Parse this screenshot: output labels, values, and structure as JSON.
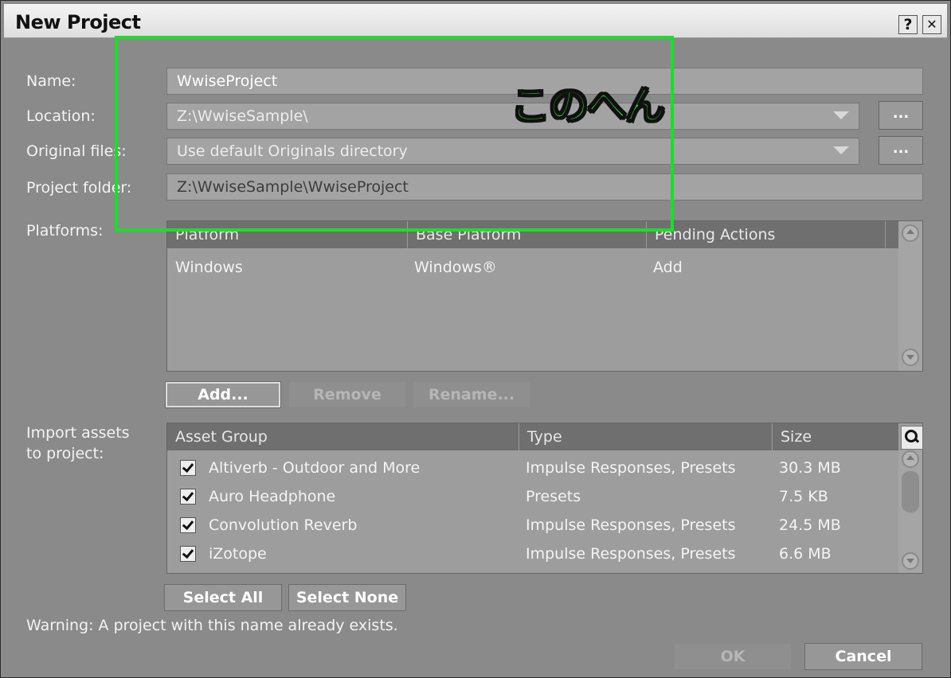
{
  "window": {
    "title": "New Project",
    "help_label": "?",
    "close_label": "✕"
  },
  "form": {
    "name_label": "Name:",
    "name_value": "WwiseProject",
    "location_label": "Location:",
    "location_value": "Z:\\WwiseSample\\",
    "originals_label": "Original files:",
    "originals_value": "Use default Originals directory",
    "project_folder_label": "Project folder:",
    "project_folder_value": "Z:\\WwiseSample\\WwiseProject",
    "browse_label": "..."
  },
  "platforms": {
    "label": "Platforms:",
    "columns": [
      "Platform",
      "Base Platform",
      "Pending Actions"
    ],
    "rows": [
      [
        "Windows",
        "Windows®",
        "Add"
      ]
    ],
    "add_label": "Add...",
    "remove_label": "Remove",
    "rename_label": "Rename..."
  },
  "assets": {
    "label": "Import assets\nto project:",
    "columns": [
      "Asset Group",
      "Type",
      "Size"
    ],
    "rows": [
      {
        "checked": true,
        "group": "Altiverb - Outdoor and More",
        "type": "Impulse Responses, Presets",
        "size": "30.3 MB"
      },
      {
        "checked": true,
        "group": "Auro Headphone",
        "type": "Presets",
        "size": "7.5 KB"
      },
      {
        "checked": true,
        "group": "Convolution Reverb",
        "type": "Impulse Responses, Presets",
        "size": "24.5 MB"
      },
      {
        "checked": true,
        "group": "iZotope",
        "type": "Impulse Responses, Presets",
        "size": "6.6 MB"
      }
    ],
    "select_all_label": "Select All",
    "select_none_label": "Select None"
  },
  "warning": "Warning: A project with this name already exists.",
  "footer": {
    "ok_label": "OK",
    "cancel_label": "Cancel"
  },
  "annotation": {
    "text": "このへん",
    "color": "#19e024"
  }
}
